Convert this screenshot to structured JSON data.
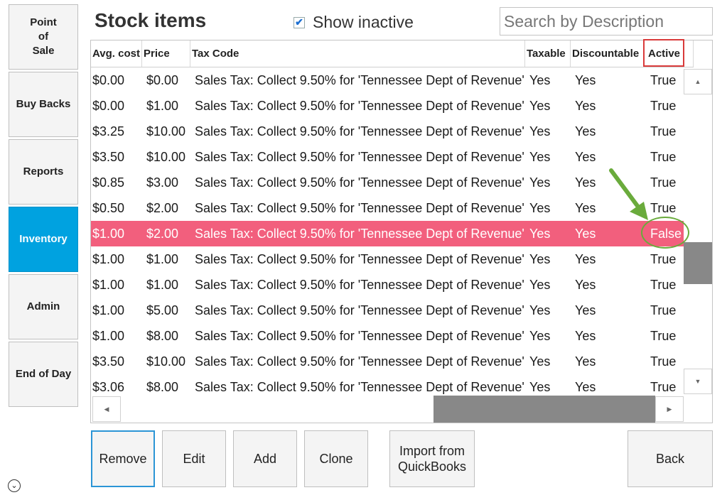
{
  "sidebar": {
    "items": [
      {
        "label": "Point\nof\nSale",
        "active": false
      },
      {
        "label": "Buy Backs",
        "active": false
      },
      {
        "label": "Reports",
        "active": false
      },
      {
        "label": "Inventory",
        "active": true
      },
      {
        "label": "Admin",
        "active": false
      },
      {
        "label": "End of Day",
        "active": false
      }
    ]
  },
  "header": {
    "title": "Stock items",
    "show_inactive_label": "Show inactive",
    "show_inactive_checked": true,
    "search_placeholder": "Search by Description"
  },
  "table": {
    "columns": [
      "Avg. cost",
      "Price",
      "Tax Code",
      "Taxable",
      "Discountable",
      "Active"
    ],
    "rows": [
      [
        "$0.00",
        "$0.00",
        "Sales Tax: Collect 9.50% for 'Tennessee Dept of Revenue'",
        "Yes",
        "Yes",
        "True"
      ],
      [
        "$0.00",
        "$1.00",
        "Sales Tax: Collect 9.50% for 'Tennessee Dept of Revenue'",
        "Yes",
        "Yes",
        "True"
      ],
      [
        "$3.25",
        "$10.00",
        "Sales Tax: Collect 9.50% for 'Tennessee Dept of Revenue'",
        "Yes",
        "Yes",
        "True"
      ],
      [
        "$3.50",
        "$10.00",
        "Sales Tax: Collect 9.50% for 'Tennessee Dept of Revenue'",
        "Yes",
        "Yes",
        "True"
      ],
      [
        "$0.85",
        "$3.00",
        "Sales Tax: Collect 9.50% for 'Tennessee Dept of Revenue'",
        "Yes",
        "Yes",
        "True"
      ],
      [
        "$0.50",
        "$2.00",
        "Sales Tax: Collect 9.50% for 'Tennessee Dept of Revenue'",
        "Yes",
        "Yes",
        "True"
      ],
      [
        "$1.00",
        "$2.00",
        "Sales Tax: Collect 9.50% for 'Tennessee Dept of Revenue'",
        "Yes",
        "Yes",
        "False"
      ],
      [
        "$1.00",
        "$1.00",
        "Sales Tax: Collect 9.50% for 'Tennessee Dept of Revenue'",
        "Yes",
        "Yes",
        "True"
      ],
      [
        "$1.00",
        "$1.00",
        "Sales Tax: Collect 9.50% for 'Tennessee Dept of Revenue'",
        "Yes",
        "Yes",
        "True"
      ],
      [
        "$1.00",
        "$5.00",
        "Sales Tax: Collect 9.50% for 'Tennessee Dept of Revenue'",
        "Yes",
        "Yes",
        "True"
      ],
      [
        "$1.00",
        "$8.00",
        "Sales Tax: Collect 9.50% for 'Tennessee Dept of Revenue'",
        "Yes",
        "Yes",
        "True"
      ],
      [
        "$3.50",
        "$10.00",
        "Sales Tax: Collect 9.50% for 'Tennessee Dept of Revenue'",
        "Yes",
        "Yes",
        "True"
      ],
      [
        "$3.06",
        "$8.00",
        "Sales Tax: Collect 9.50% for 'Tennessee Dept of Revenue'",
        "Yes",
        "Yes",
        "True"
      ]
    ],
    "highlighted_row": 6
  },
  "footer": {
    "buttons": [
      {
        "label": "Remove",
        "focused": true
      },
      {
        "label": "Edit",
        "focused": false
      },
      {
        "label": "Add",
        "focused": false
      },
      {
        "label": "Clone",
        "focused": false
      },
      {
        "label": "Import from\nQuickBooks",
        "focused": false
      },
      {
        "label": "Back",
        "focused": false
      }
    ]
  },
  "colors": {
    "nav_active": "#00a2e0",
    "row_highlight": "#f25f7d",
    "annotation_box": "#d93a3a",
    "annotation_arrow": "#6aab3c",
    "checkbox_check": "#1c6fd1"
  },
  "icons": {
    "check": "✔",
    "scroll_up": "▲",
    "scroll_down": "▼",
    "scroll_left": "◀",
    "scroll_right": "▶",
    "collapse": "⌄"
  }
}
